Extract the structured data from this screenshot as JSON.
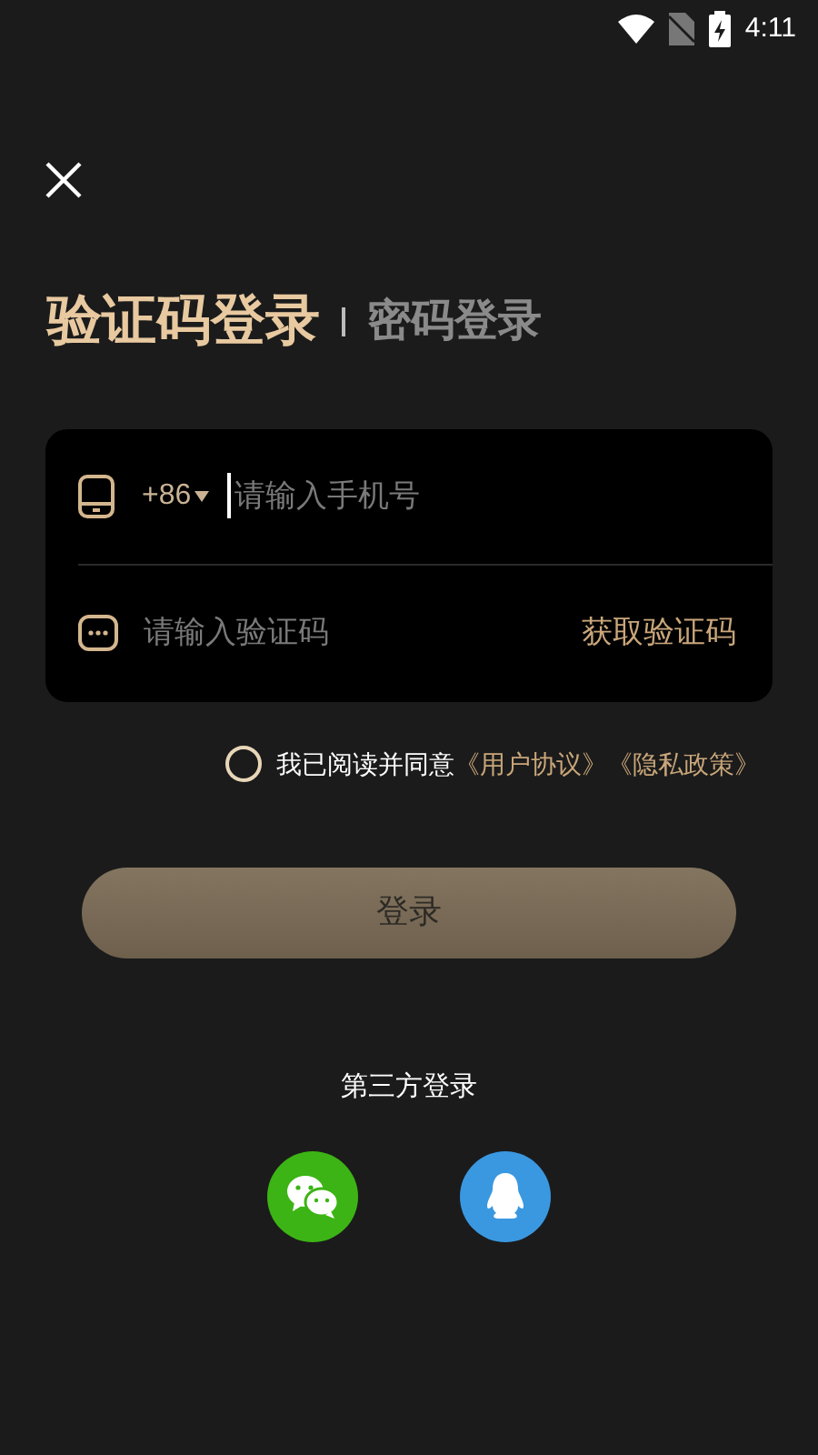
{
  "status_bar": {
    "time": "4:11"
  },
  "tabs": [
    {
      "label": "验证码登录",
      "selected": true
    },
    {
      "label": "密码登录",
      "selected": false
    }
  ],
  "phone_field": {
    "country_code": "+86",
    "placeholder": "请输入手机号"
  },
  "code_field": {
    "placeholder": "请输入验证码",
    "action": "获取验证码"
  },
  "agreement": {
    "checked": false,
    "text": "我已阅读并同意",
    "links": [
      "《用户协议》",
      "《隐私政策》"
    ]
  },
  "login_button": "登录",
  "third_party": {
    "title": "第三方登录",
    "providers": [
      {
        "kind": "wechat"
      },
      {
        "kind": "qq"
      }
    ]
  }
}
